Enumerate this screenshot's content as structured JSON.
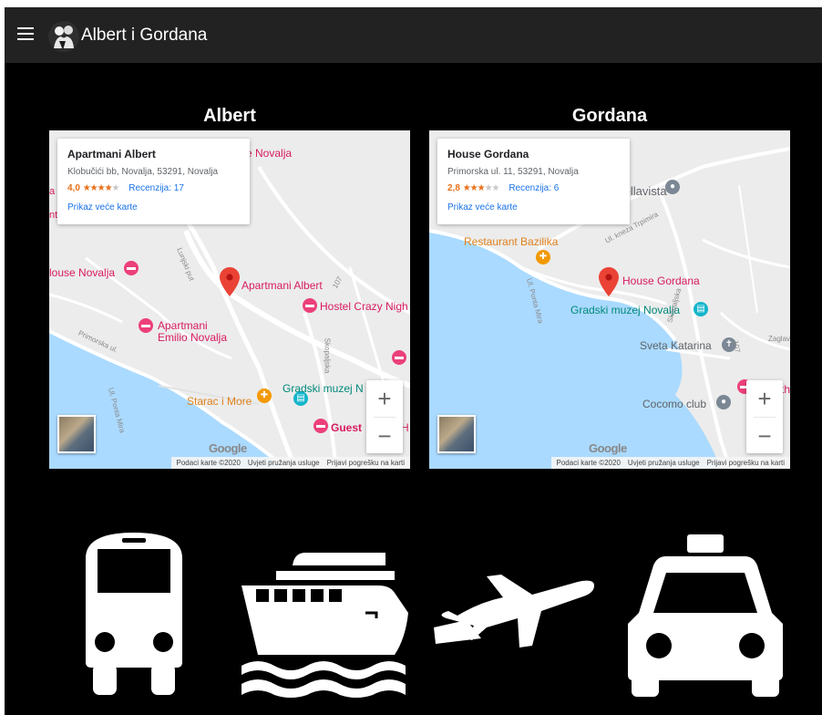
{
  "app": {
    "title": "Albert i Gordana"
  },
  "maps": [
    {
      "heading": "Albert",
      "info": {
        "name": "Apartmani Albert",
        "address": "Klobučići bb, Novalja, 53291, Novalja",
        "rating": "4,0",
        "stars": "★★★★",
        "stars_off": "★",
        "reviews": "Recenzija: 17",
        "link": "Prikaz veće karte"
      },
      "labels": {
        "hostel_crazy": "Hostel Crazy Nigh",
        "pin": "Apartmani Albert",
        "house_novalja": "louse Novalja",
        "se_novalja": "se Novalja",
        "apartmani_emilio_1": "Apartmani",
        "apartmani_emilio_2": "Emilio Novalja",
        "starac": "Starac i More",
        "gradski": "Gradski muzej N",
        "guest": "Guest",
        "h": "H",
        "lunjski": "Lunjski put",
        "primorska": "Primorska ul.",
        "ul_ponta": "Ul. Ponta Mira",
        "skopaljska": "Skopaljska",
        "road107": "107",
        "partial_a": "a",
        "partial_t": "nt"
      },
      "attribution": [
        "Podaci karte ©2020",
        "Uvjeti pružanja usluge",
        "Prijavi pogrešku na karti"
      ],
      "google": "Google"
    },
    {
      "heading": "Gordana",
      "info": {
        "name": "House Gordana",
        "address": "Primorska ul. 11, 53291, Novalja",
        "rating": "2,8",
        "stars": "★★★",
        "stars_off": "★★",
        "reviews": "Recenzija: 6",
        "link": "Prikaz veće karte"
      },
      "labels": {
        "bellavista": "Bellavista",
        "restaurant": "Restaurant Bazilika",
        "pin": "House Gordana",
        "gradski": "Gradski muzej Novalja",
        "sveta": "Sveta Katarina",
        "cocomo": "Cocomo club",
        "ul_kneza": "Ul. kneza Trpimira",
        "ul_ponta": "Ul. Ponta Mira",
        "skopaljska": "Skopaljska",
        "road107": "107",
        "zaglav": "Zaglav",
        "th": "th"
      },
      "attribution": [
        "Podaci karte ©2020",
        "Uvjeti pružanja usluge",
        "Prijavi pogrešku na karti"
      ],
      "google": "Google"
    }
  ],
  "zoom": {
    "in": "+",
    "out": "−"
  },
  "transport": [
    "bus-icon",
    "ferry-icon",
    "airplane-icon",
    "taxi-icon"
  ],
  "colors": {
    "topbar": "#222222",
    "background": "#000000",
    "pin": "#ea4335",
    "poi_pink": "#d81b60",
    "water": "#aadaff"
  }
}
